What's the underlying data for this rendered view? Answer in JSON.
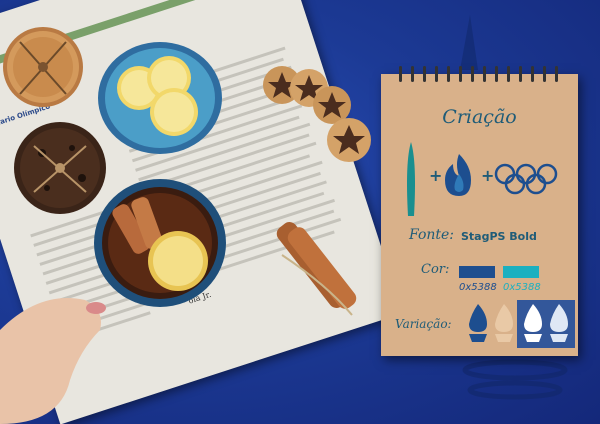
{
  "notebook": {
    "title": "Criação",
    "plus_1": "+",
    "plus_2": "+",
    "font_label": "Fonte:",
    "font_name": "StagPS Bold",
    "color_label": "Cor:",
    "color_codes": [
      "0x5388",
      "0x5388"
    ],
    "variation_label": "Variação:",
    "swatch_colors": [
      "#1d4e8f",
      "#1bb0c0"
    ]
  },
  "newspaper": {
    "masthead": "Diario Olímpico",
    "byline": "ola Jr."
  }
}
